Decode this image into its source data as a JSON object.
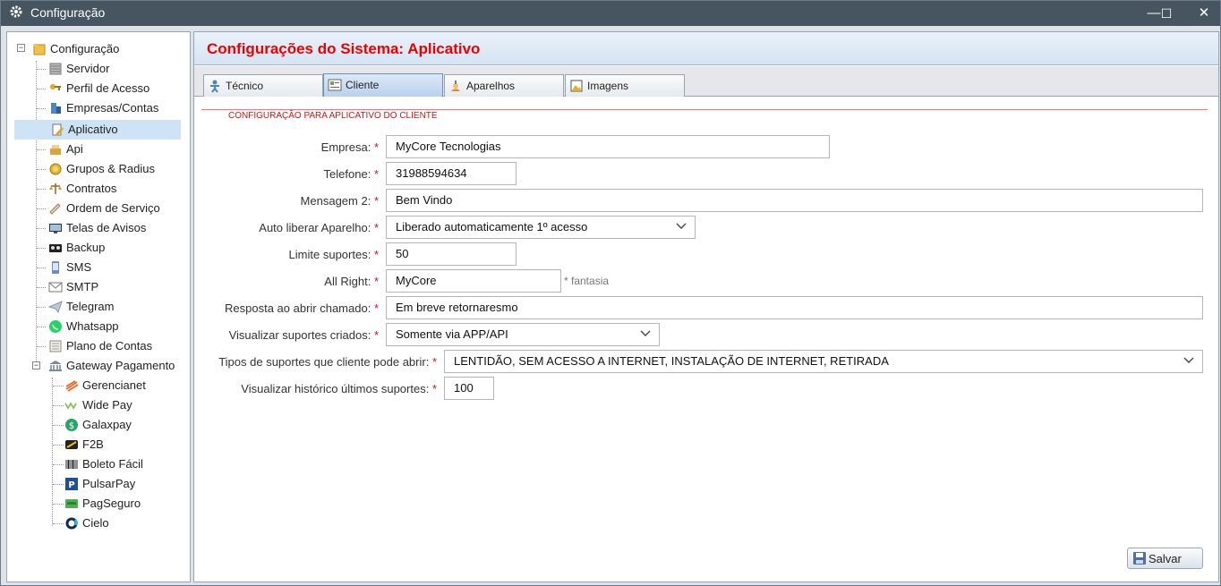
{
  "window": {
    "title": "Configuração",
    "minimize_label": "—",
    "maximize_label": "☐",
    "close_label": "✕"
  },
  "tree": {
    "root": {
      "label": "Configuração",
      "icon": "folder-icon",
      "expander": "−"
    },
    "items": [
      {
        "label": "Servidor",
        "icon": "server-icon"
      },
      {
        "label": "Perfil de Acesso",
        "icon": "key-icon"
      },
      {
        "label": "Empresas/Contas",
        "icon": "building-icon"
      },
      {
        "label": "Aplicativo",
        "icon": "app-edit-icon",
        "selected": true
      },
      {
        "label": "Api",
        "icon": "api-icon"
      },
      {
        "label": "Grupos & Radius",
        "icon": "coin-icon"
      },
      {
        "label": "Contratos",
        "icon": "scales-icon"
      },
      {
        "label": "Ordem de Serviço",
        "icon": "pencil-icon"
      },
      {
        "label": "Telas de Avisos",
        "icon": "screen-icon"
      },
      {
        "label": "Backup",
        "icon": "backup-icon"
      },
      {
        "label": "SMS",
        "icon": "phone-icon"
      },
      {
        "label": "SMTP",
        "icon": "mail-icon"
      },
      {
        "label": "Telegram",
        "icon": "telegram-icon"
      },
      {
        "label": "Whatsapp",
        "icon": "whatsapp-icon"
      },
      {
        "label": "Plano de Contas",
        "icon": "ledger-icon"
      }
    ],
    "gateway": {
      "label": "Gateway Pagamento",
      "icon": "bank-icon",
      "expander": "−",
      "children": [
        {
          "label": "Gerencianet",
          "icon": "gerencianet-icon"
        },
        {
          "label": "Wide Pay",
          "icon": "widepay-icon"
        },
        {
          "label": "Galaxpay",
          "icon": "galaxpay-icon"
        },
        {
          "label": "F2B",
          "icon": "f2b-icon"
        },
        {
          "label": "Boleto Fácil",
          "icon": "barcode-icon"
        },
        {
          "label": "PulsarPay",
          "icon": "pulsarpay-icon"
        },
        {
          "label": "PagSeguro",
          "icon": "pagseguro-icon"
        },
        {
          "label": "Cielo",
          "icon": "cielo-icon"
        }
      ]
    }
  },
  "header": {
    "title": "Configurações do Sistema: Aplicativo"
  },
  "tabs": [
    {
      "label": "Técnico",
      "icon": "technician-icon"
    },
    {
      "label": "Cliente",
      "icon": "client-icon",
      "active": true
    },
    {
      "label": "Aparelhos",
      "icon": "device-icon"
    },
    {
      "label": "Imagens",
      "icon": "image-icon"
    }
  ],
  "form": {
    "legend": "CONFIGURAÇÃO PARA APLICATIVO DO CLIENTE",
    "required_mark": "*",
    "fields": {
      "empresa": {
        "label": "Empresa:",
        "value": "MyCore Tecnologias"
      },
      "telefone": {
        "label": "Telefone:",
        "value": "31988594634"
      },
      "mensagem2": {
        "label": "Mensagem 2:",
        "value": "Bem Vindo"
      },
      "auto_liberar": {
        "label": "Auto liberar Aparelho:",
        "value": "Liberado automaticamente 1º acesso"
      },
      "limite": {
        "label": "Limite suportes:",
        "value": "50"
      },
      "all_right": {
        "label": "All Right:",
        "value": "MyCore",
        "hint": "* fantasia"
      },
      "resposta": {
        "label": "Resposta ao abrir chamado:",
        "value": "Em breve retornaresmo"
      },
      "visualizar": {
        "label": "Visualizar suportes criados:",
        "value": "Somente via APP/API"
      },
      "tipos": {
        "label": "Tipos de suportes que cliente pode abrir:",
        "value": "LENTIDÃO, SEM ACESSO A INTERNET, INSTALAÇÃO DE INTERNET, RETIRADA"
      },
      "historico": {
        "label": "Visualizar histórico últimos suportes:",
        "value": "100"
      }
    },
    "save_label": "Salvar"
  },
  "colors": {
    "title_bar": "#46555f",
    "header_title": "#ee0000",
    "required": "#dd1111",
    "selection": "#cfe3f6"
  }
}
